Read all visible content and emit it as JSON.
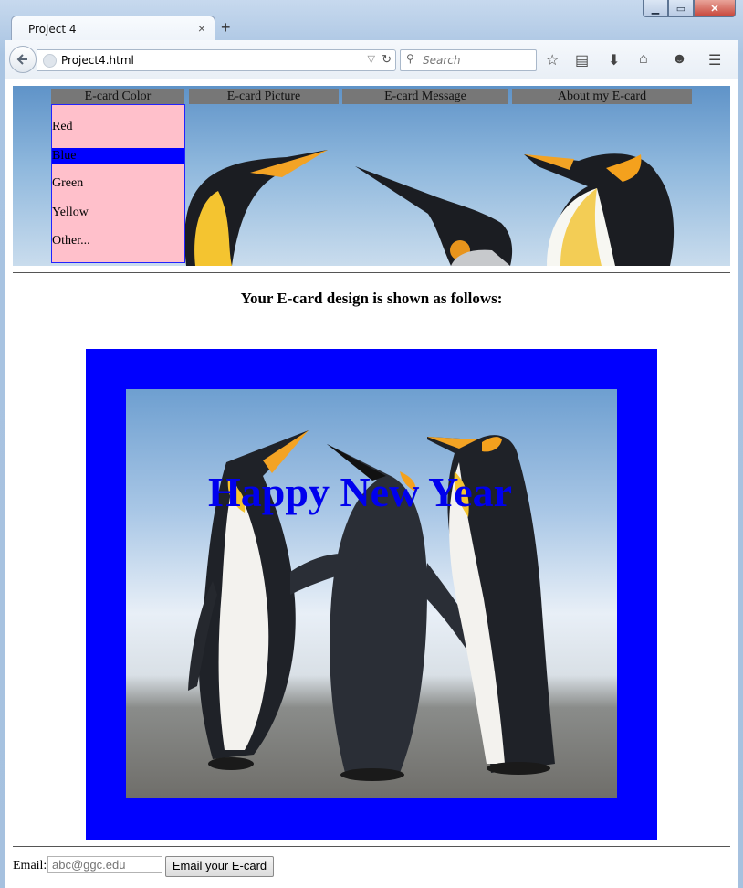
{
  "browser": {
    "tab_title": "Project 4",
    "tab_close": "×",
    "new_tab": "+",
    "url": "Project4.html",
    "search_placeholder": "Search",
    "toolbar_icons": [
      "star-icon",
      "reading-list-icon",
      "download-icon",
      "home-icon",
      "hello-icon",
      "menu-icon"
    ]
  },
  "nav_menu": {
    "items": [
      "E-card Color",
      "E-card Picture",
      "E-card Message",
      "About my E-card"
    ]
  },
  "color_dropdown": {
    "options": [
      "Red",
      "Blue",
      "Green",
      "Yellow",
      "Other..."
    ],
    "selected": "Blue"
  },
  "main": {
    "heading": "Your E-card design is shown as follows:",
    "card_message": "Happy New Year",
    "card_border_color": "#0000ff",
    "card_text_color": "#0000ee"
  },
  "email": {
    "label": "Email:",
    "placeholder": "abc@ggc.edu",
    "button_label": "Email your E-card"
  },
  "colors": {
    "dropdown_bg": "#ffc0cb",
    "menu_bg": "#777777",
    "selected_bg": "#0000ff"
  }
}
